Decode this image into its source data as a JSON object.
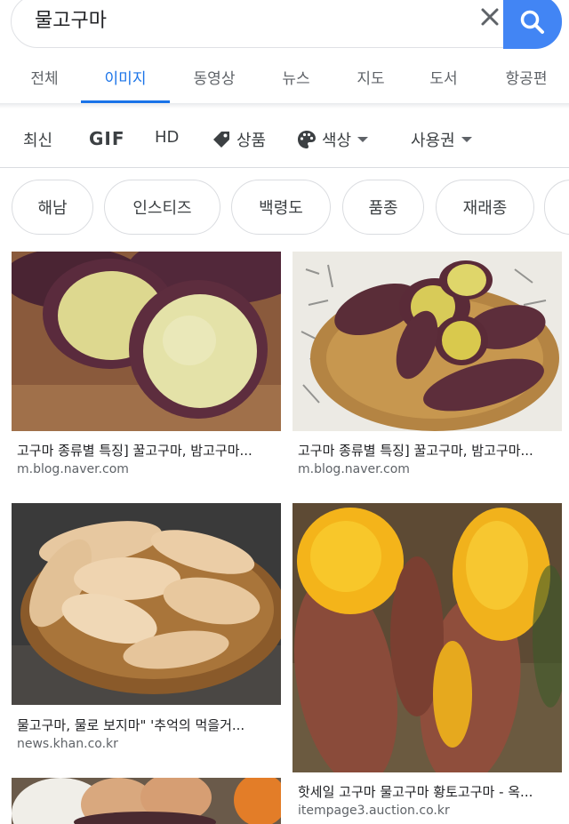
{
  "search": {
    "query": "물고구마"
  },
  "tabs": [
    "전체",
    "이미지",
    "동영상",
    "뉴스",
    "지도",
    "도서",
    "항공편"
  ],
  "tools": {
    "latest": "최신",
    "gif": "GIF",
    "hd": "HD",
    "products": "상품",
    "color": "색상",
    "usage_rights": "사용권"
  },
  "chips": [
    "해남",
    "인스티즈",
    "백령도",
    "품종",
    "재래종"
  ],
  "results": [
    {
      "title": "고구마 종류별 특징] 꿀고구마, 밤고구마...",
      "source": "m.blog.naver.com",
      "image": "halved-purple-sweet-potatoes"
    },
    {
      "title": "고구마 종류별 특징] 꿀고구마, 밤고구마...",
      "source": "m.blog.naver.com",
      "image": "sweet-potatoes-in-basket"
    },
    {
      "title": "물고구마, 물로 보지마\" '추억의 먹을거...",
      "source": "news.khan.co.kr",
      "image": "white-sweet-potatoes-in-basket"
    },
    {
      "title": "핫세일 고구마 물고구마 황토고구마 - 옥...",
      "source": "itempage3.auction.co.kr",
      "image": "baked-yellow-sweet-potatoes"
    },
    {
      "title": "",
      "source": "",
      "image": "eggs-and-sweet-potato"
    }
  ],
  "colors": {
    "accent": "#1a73e8",
    "search_button": "#4285f4"
  }
}
